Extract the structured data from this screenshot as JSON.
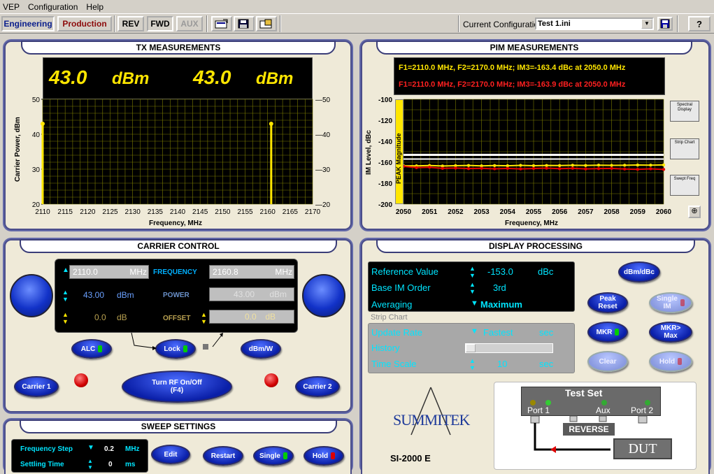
{
  "menu": {
    "items": [
      "VEP",
      "Configuration",
      "Help"
    ]
  },
  "toolbar": {
    "engineering": "Engineering",
    "production": "Production",
    "rev": "REV",
    "fwd": "FWD",
    "aux": "AUX",
    "config_label": "Current Configuration:",
    "config_value": "Test 1.ini",
    "help": "?"
  },
  "tx": {
    "title": "TX MEASUREMENTS",
    "val1": "43.0",
    "unit1": "dBm",
    "val2": "43.0",
    "unit2": "dBm",
    "ylabel": "Carrier Power, dBm",
    "xlabel": "Frequency, MHz"
  },
  "pim": {
    "title": "PIM MEASUREMENTS",
    "line1": "F1=2110.0 MHz, F2=2170.0 MHz;  IM3=-163.4 dBc at 2050.0 MHz",
    "line2": "F1=2110.0 MHz, F2=2170.0 MHz;  IM3=-163.9 dBc at 2050.0 MHz",
    "ylabel": "IM Level, dBc",
    "xlabel": "Frequency, MHz",
    "peak": "PEAK Magnitude",
    "side_buttons": [
      "Spectral Display",
      "Strip Chart",
      "Swept Freq"
    ]
  },
  "carrier": {
    "title": "CARRIER CONTROL",
    "f1": "2110.0",
    "f1_unit": "MHz",
    "freq_label": "FREQUENCY",
    "f2": "2160.8",
    "f2_unit": "MHz",
    "p1": "43.00",
    "p1_unit": "dBm",
    "power_label": "POWER",
    "p2": "43.00",
    "p2_unit": "dBm",
    "o1": "0.0",
    "o1_unit": "dB",
    "offset_label": "OFFSET",
    "o2": "0.0",
    "o2_unit": "dB",
    "alc": "ALC",
    "lock": "Lock",
    "dbmw": "dBm/W",
    "carrier1": "Carrier 1",
    "carrier2": "Carrier 2",
    "rf_line1": "Turn RF On/Off",
    "rf_line2": "(F4)"
  },
  "sweep": {
    "title": "SWEEP SETTINGS",
    "step_label": "Frequency Step",
    "step_val": "0.2",
    "step_unit": "MHz",
    "settle_label": "Settling Time",
    "settle_val": "0",
    "settle_unit": "ms",
    "edit": "Edit",
    "restart": "Restart",
    "single": "Single",
    "hold": "Hold"
  },
  "display": {
    "title": "DISPLAY PROCESSING",
    "ref_label": "Reference Value",
    "ref_val": "-153.0",
    "ref_unit": "dBc",
    "order_label": "Base IM Order",
    "order_val": "3rd",
    "avg_label": "Averaging",
    "avg_val": "Maximum",
    "strip_label": "Strip Chart",
    "rate_label": "Update Rate",
    "rate_val": "Fastest",
    "rate_unit": "sec",
    "history_label": "History",
    "scale_label": "Time Scale",
    "scale_val": "10",
    "scale_unit": "sec",
    "dbmdbc": "dBm/dBc",
    "peak_reset_1": "Peak",
    "peak_reset_2": "Reset",
    "single_1": "Single",
    "single_2": "IM",
    "mkr": "MKR",
    "mkrmax_1": "MKR>",
    "mkrmax_2": "Max",
    "clear": "Clear",
    "hold": "Hold",
    "logo": "SUMMITEK",
    "model": "SI-2000 E",
    "testset": "Test Set",
    "port1": "Port 1",
    "aux": "Aux",
    "port2": "Port 2",
    "reverse": "REVERSE",
    "dut": "DUT"
  },
  "chart_data": [
    {
      "type": "line",
      "title": "",
      "xlabel": "Frequency, MHz",
      "ylabel": "Carrier Power, dBm",
      "x_ticks": [
        "2110",
        "2115",
        "2120",
        "2125",
        "2130",
        "2135",
        "2140",
        "2145",
        "2150",
        "2155",
        "2160",
        "2165",
        "2170"
      ],
      "y_ticks": [
        "50",
        "40",
        "30",
        "20"
      ],
      "y_ticks_right": [
        "50",
        "40",
        "30",
        "20"
      ],
      "xlim": [
        2110,
        2170
      ],
      "ylim": [
        20,
        50
      ],
      "grid": true,
      "series": [
        {
          "values": [
            {
              "x": 2110.0,
              "y": 43.0
            },
            {
              "x": 2160.8,
              "y": 43.0
            }
          ],
          "color": "#ffe600"
        }
      ]
    },
    {
      "type": "line",
      "title": "",
      "xlabel": "Frequency, MHz",
      "ylabel": "IM Level, dBc",
      "x_ticks": [
        "2050",
        "2051",
        "2052",
        "2053",
        "2054",
        "2055",
        "2056",
        "2057",
        "2058",
        "2059",
        "2060"
      ],
      "y_ticks": [
        "-100",
        "-120",
        "-140",
        "-160",
        "-180",
        "-200"
      ],
      "xlim": [
        2050,
        2060
      ],
      "ylim": [
        -200,
        -100
      ],
      "grid": true,
      "reference": -153.0,
      "series": [
        {
          "color": "#ffe600",
          "x": [
            2050,
            2050.5,
            2051,
            2051.5,
            2052,
            2052.5,
            2053,
            2053.5,
            2054,
            2054.5,
            2055,
            2055.5,
            2056,
            2056.5,
            2057,
            2057.5,
            2058,
            2058.5,
            2059,
            2059.5,
            2060
          ],
          "values": [
            -163.4,
            -163.5,
            -163.2,
            -163.6,
            -163.3,
            -163.1,
            -163.5,
            -163.2,
            -163.4,
            -163,
            -163.3,
            -163.1,
            -163.2,
            -162.9,
            -163.1,
            -162.8,
            -163,
            -162.9,
            -162.7,
            -162.8,
            -162.6
          ]
        },
        {
          "color": "#e00000",
          "x": [
            2050,
            2050.5,
            2051,
            2051.5,
            2052,
            2052.5,
            2053,
            2053.5,
            2054,
            2054.5,
            2055,
            2055.5,
            2056,
            2056.5,
            2057,
            2057.5,
            2058,
            2058.5,
            2059,
            2059.5,
            2060
          ],
          "values": [
            -163.9,
            -165.2,
            -164.8,
            -165.9,
            -165.6,
            -166.1,
            -165.8,
            -166.3,
            -165.9,
            -166.4,
            -166.0,
            -165.7,
            -166.2,
            -165.8,
            -166.4,
            -166.1,
            -165.9,
            -166.5,
            -166.8,
            -166.3,
            -166.9
          ]
        }
      ]
    }
  ]
}
